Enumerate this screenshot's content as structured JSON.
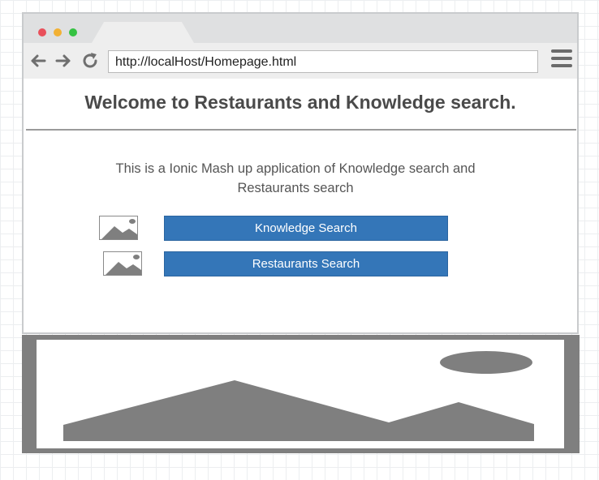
{
  "browser": {
    "url": "http://localHost/Homepage.html",
    "nav_icons": [
      "back-arrow-icon",
      "forward-arrow-icon",
      "reload-icon",
      "hamburger-menu-icon"
    ],
    "colors": {
      "close": "#e9505b",
      "minimize": "#f2b134",
      "maximize": "#35c242"
    }
  },
  "page": {
    "title": "Welcome to Restaurants and Knowledge search.",
    "description": "This is a Ionic Mash up application of Knowledge search and Restaurants search",
    "buttons": [
      {
        "label": "Knowledge Search",
        "icon": "image-placeholder-icon"
      },
      {
        "label": "Restaurants Search",
        "icon": "image-placeholder-icon"
      }
    ],
    "accent_color": "#3476b8"
  },
  "footer": {
    "icon": "image-placeholder-icon"
  }
}
